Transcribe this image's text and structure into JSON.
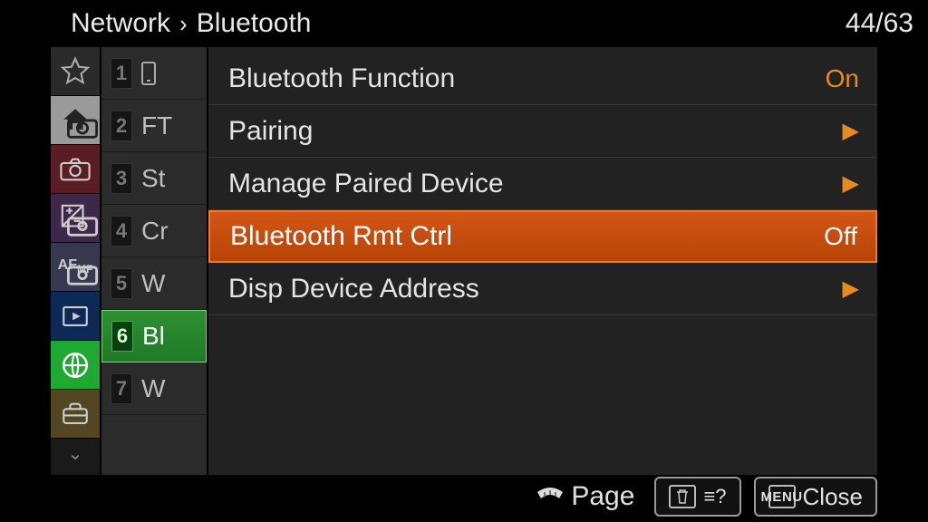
{
  "header": {
    "crumb_root": "Network",
    "crumb_leaf": "Bluetooth",
    "page_current": "44",
    "page_sep": "/",
    "page_total": "63"
  },
  "submenu": {
    "items": [
      {
        "num": "1",
        "text": ""
      },
      {
        "num": "2",
        "text": "FT"
      },
      {
        "num": "3",
        "text": "St"
      },
      {
        "num": "4",
        "text": "Cr"
      },
      {
        "num": "5",
        "text": "W"
      },
      {
        "num": "6",
        "text": "Bl"
      },
      {
        "num": "7",
        "text": "W"
      }
    ],
    "selected_index": 5
  },
  "main_list": {
    "selected_index": 3,
    "items": [
      {
        "label": "Bluetooth Function",
        "value": "On",
        "value_accent": true,
        "arrow": false
      },
      {
        "label": "Pairing",
        "value": "",
        "arrow": true
      },
      {
        "label": "Manage Paired Device",
        "value": "",
        "arrow": true
      },
      {
        "label": "Bluetooth Rmt Ctrl",
        "value": "Off",
        "arrow": false
      },
      {
        "label": "Disp Device Address",
        "value": "",
        "arrow": true
      }
    ]
  },
  "footer": {
    "page_label": "Page",
    "help_icon_hint": "?",
    "close_label": "Close",
    "menu_label": "MENU"
  },
  "colors": {
    "accent": "#e78a1f",
    "selected_bg": "#c94c0c",
    "network_green": "#1fa832"
  }
}
